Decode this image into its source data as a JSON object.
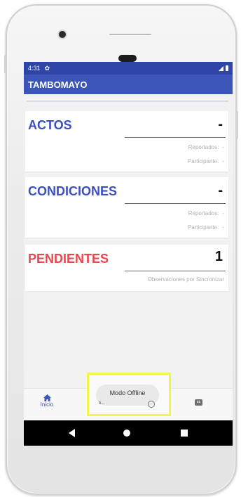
{
  "status_bar": {
    "time": "4:31"
  },
  "app_bar": {
    "title": "TAMBOMAYO"
  },
  "cards": {
    "actos": {
      "title": "ACTOS",
      "value": "-",
      "reportados_label": "Reportados:",
      "reportados_value": "-",
      "participante_label": "Participante:",
      "participante_value": "-"
    },
    "condiciones": {
      "title": "CONDICIONES",
      "value": "-",
      "reportados_label": "Reportados:",
      "reportados_value": "-",
      "participante_label": "Participante:",
      "participante_value": "-"
    },
    "pendientes": {
      "title": "PENDIENTES",
      "value": "1",
      "subtitle": "Observaciones por Sincronizar"
    }
  },
  "bottom_nav": {
    "home_label": "Inicio",
    "cc_icon_text": "cc"
  },
  "toast": {
    "message": "Modo Offline",
    "small_text": "b..."
  },
  "colors": {
    "app_bar": "#3b56b8",
    "status_bar": "#2f46a7",
    "title_blue": "#3b4fc3",
    "title_red": "#e8474f",
    "highlight": "#f2f54a"
  },
  "icons": [
    "gear-icon",
    "signal-icon",
    "battery-icon",
    "home-icon",
    "cc-icon",
    "back-icon",
    "home-circle-icon",
    "recents-icon",
    "clock-icon"
  ]
}
